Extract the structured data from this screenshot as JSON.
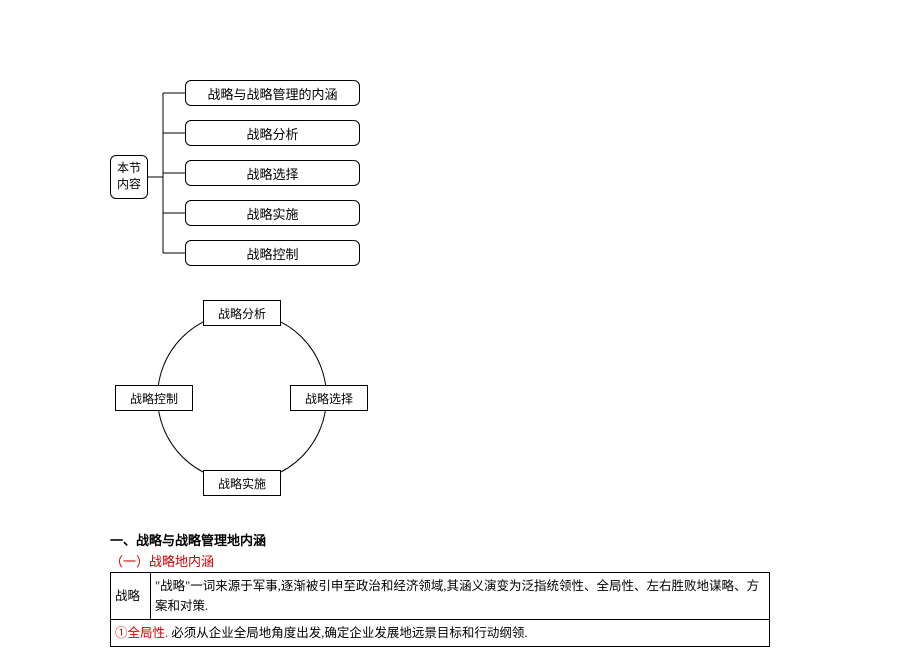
{
  "tree": {
    "root": "本节\n内容",
    "leaves": [
      "战略与战略管理的内涵",
      "战略分析",
      "战略选择",
      "战略实施",
      "战略控制"
    ]
  },
  "cycle": {
    "top": "战略分析",
    "right": "战略选择",
    "bottom": "战略实施",
    "left": "战略控制"
  },
  "heading1": "一、战略与战略管理地内涵",
  "subheading1": "（一）战略地内涵",
  "table": {
    "row1_label": "战略",
    "row1_text": "\"战略\"一词来源于军事,逐渐被引申至政治和经济领域,其涵义演变为泛指统领性、全局性、左右胜败地谋略、方案和对策.",
    "row2_red": "①全局性.",
    "row2_text": "必须从企业全局地角度出发,确定企业发展地远景目标和行动纲领."
  },
  "chart_data": [
    {
      "type": "tree",
      "title": "本节内容",
      "root": "本节内容",
      "children": [
        "战略与战略管理的内涵",
        "战略分析",
        "战略选择",
        "战略实施",
        "战略控制"
      ]
    },
    {
      "type": "cycle",
      "nodes": [
        "战略分析",
        "战略选择",
        "战略实施",
        "战略控制"
      ],
      "direction": "clockwise"
    }
  ]
}
